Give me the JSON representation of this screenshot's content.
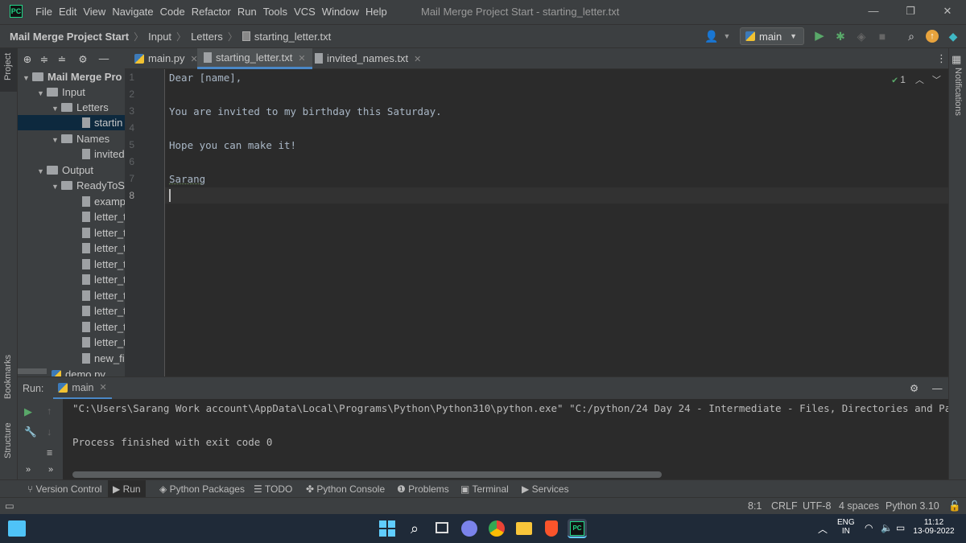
{
  "window": {
    "title": "Mail Merge Project Start - starting_letter.txt"
  },
  "menu": [
    "File",
    "Edit",
    "View",
    "Navigate",
    "Code",
    "Refactor",
    "Run",
    "Tools",
    "VCS",
    "Window",
    "Help"
  ],
  "navbar": {
    "breadcrumbs": [
      "Mail Merge Project Start",
      "Input",
      "Letters",
      "starting_letter.txt"
    ],
    "branch": "main"
  },
  "left_stripe": {
    "project": "Project",
    "bookmarks": "Bookmarks",
    "structure": "Structure"
  },
  "right_stripe": {
    "notifications": "Notifications"
  },
  "project_tree": [
    {
      "label": "Mail Merge Pro",
      "type": "folder"
    },
    {
      "label": "Input",
      "type": "folder"
    },
    {
      "label": "Letters",
      "type": "folder"
    },
    {
      "label": "startin",
      "type": "file"
    },
    {
      "label": "Names",
      "type": "folder"
    },
    {
      "label": "invited",
      "type": "file"
    },
    {
      "label": "Output",
      "type": "folder"
    },
    {
      "label": "ReadyToS",
      "type": "folder"
    },
    {
      "label": "examp",
      "type": "file"
    },
    {
      "label": "letter_t",
      "type": "file"
    },
    {
      "label": "letter_t",
      "type": "file"
    },
    {
      "label": "letter_t",
      "type": "file"
    },
    {
      "label": "letter_t",
      "type": "file"
    },
    {
      "label": "letter_t",
      "type": "file"
    },
    {
      "label": "letter_t",
      "type": "file"
    },
    {
      "label": "letter_t",
      "type": "file"
    },
    {
      "label": "letter_t",
      "type": "file"
    },
    {
      "label": "letter_t",
      "type": "file"
    },
    {
      "label": "new_fil",
      "type": "file"
    },
    {
      "label": "demo.py",
      "type": "py"
    }
  ],
  "tabs": [
    "main.py",
    "starting_letter.txt",
    "invited_names.txt"
  ],
  "editor": {
    "line_numbers": [
      "1",
      "2",
      "3",
      "4",
      "5",
      "6",
      "7",
      "8"
    ],
    "lines": [
      "Dear [name],",
      "",
      "You are invited to my birthday this Saturday.",
      "",
      "Hope you can make it!",
      "",
      "Sarang",
      ""
    ],
    "inspection_count": "1"
  },
  "run": {
    "label": "Run:",
    "config": "main",
    "console": [
      "\"C:\\Users\\Sarang Work account\\AppData\\Local\\Programs\\Python\\Python310\\python.exe\" \"C:/python/24 Day 24 - Intermediate - Files, Directories and Pa",
      "",
      "Process finished with exit code 0"
    ]
  },
  "tool_tabs": [
    "Version Control",
    "Run",
    "Python Packages",
    "TODO",
    "Python Console",
    "Problems",
    "Terminal",
    "Services"
  ],
  "status": {
    "position": "8:1",
    "line_sep": "CRLF",
    "encoding": "UTF-8",
    "indent": "4 spaces",
    "interpreter": "Python 3.10"
  },
  "taskbar": {
    "lang": "ENG",
    "region": "IN",
    "time": "11:12",
    "date": "13-09-2022"
  },
  "colors": {
    "accent": "#4a88c7",
    "run_green": "#59a869",
    "bg": "#2b2b2b",
    "panel": "#3c3f41"
  }
}
